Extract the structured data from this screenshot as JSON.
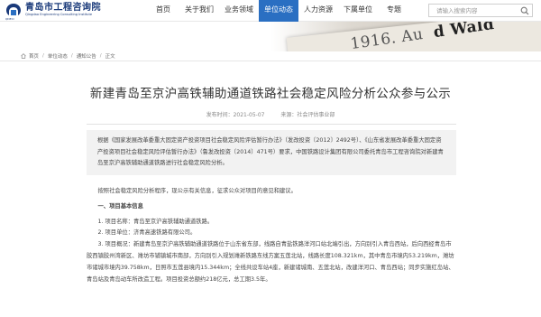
{
  "header": {
    "logo_cn": "青岛市工程咨询院",
    "logo_en": "Qingdao Engineering Consulting Institute",
    "logo_short": "QDECI",
    "nav": [
      {
        "label": "首页",
        "active": false,
        "width": 36
      },
      {
        "label": "关于我们",
        "active": false,
        "width": 44
      },
      {
        "label": "业务领域",
        "active": false,
        "width": 44
      },
      {
        "label": "单位动态",
        "active": true,
        "width": 44
      },
      {
        "label": "人力资源",
        "active": false,
        "width": 44
      },
      {
        "label": "下属单位",
        "active": false,
        "width": 44
      },
      {
        "label": "专题",
        "active": false,
        "width": 36
      }
    ],
    "search_placeholder": "请输入搜索内容"
  },
  "banner": {
    "text_thin": "1916. Au",
    "text_bold": "d Wald"
  },
  "breadcrumb": [
    "首页",
    "单位动态",
    "通知公告",
    "正文"
  ],
  "article": {
    "title": "新建青岛至京沪高铁辅助通道铁路社会稳定风险分析公众参与公示",
    "publish_time": "发布时间：2021-05-07",
    "source": "来源：社会评估事业部",
    "quote": "根据《国家发展改革委重大固定资产投资项目社会稳定风险评估暂行办法》（发改投资〔2012〕2492号）、《山东省发展改革委重大固定资产投资项目社会稳定风险评估暂行办法》（鲁发改投资〔2014〕471号）要求，中国铁路设计集团有限公司委托青岛市工程咨询院对新建青岛至京沪高铁辅助通道铁路进行社会稳定风险分析。",
    "intro": "按照社会稳定风险分析程序，现公示有关信息，征求公众对项目的意见和建议。",
    "section1": "一、项目基本信息",
    "item1": "1. 项目名称：青岛至京沪高铁辅助通道铁路。",
    "item2": "2. 项目单位：济青高速铁路有限公司。",
    "item3": "3. 项目概况：新建青岛至京沪高铁辅助通道铁路位于山东省东部，线路自青盐铁路洋河口站北端引出，方向别引入青岛西站，后向西经青岛市胶西镇胶州湾新区、潍坊市铺镇城市南部，方向别引入规划潍新铁路东线方案五莲北站，线路长度108.321km，其中青岛市境内53.219km，潍坊市诸城市境内39.758km，日照市五莲县境内15.344km；全线共设车站4座，新建诸城南、五莲北站，改建洋河口、青岛西站；同步实施红岛站、青岛站及青岛动车所改造工程。项目投资总额约218亿元，总工期3.5年。"
  }
}
